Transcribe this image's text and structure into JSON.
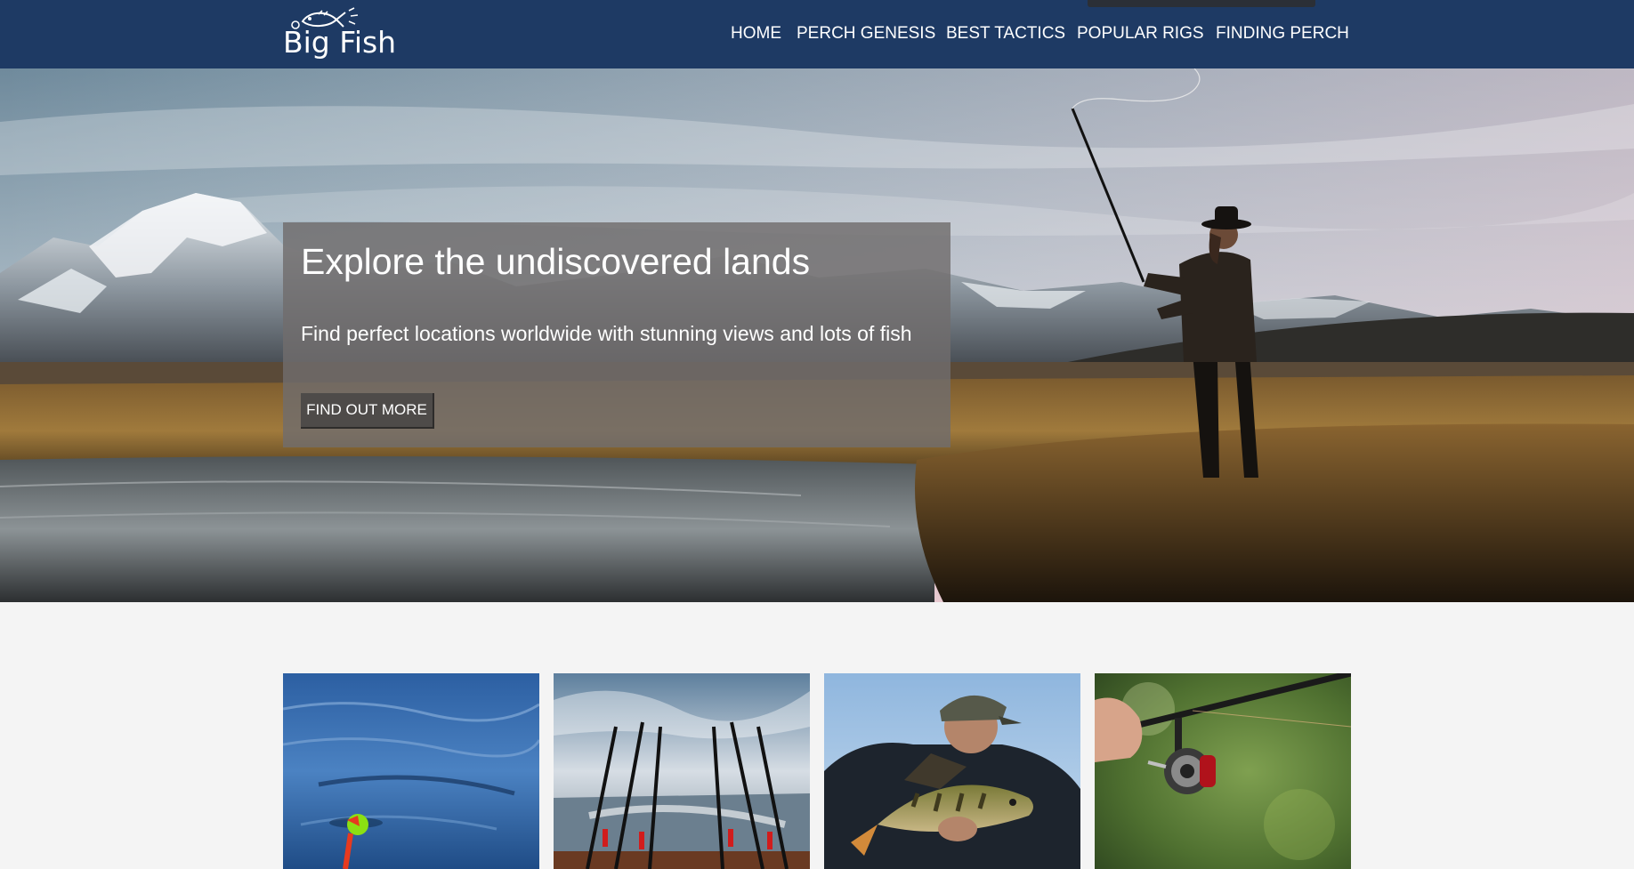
{
  "brand": {
    "logo_text": "Big Fish",
    "logo_icon": "fish-icon"
  },
  "nav": {
    "items": [
      {
        "label": "HOME"
      },
      {
        "label": "PERCH GENESIS"
      },
      {
        "label": "BEST TACTICS"
      },
      {
        "label": "POPULAR RIGS"
      },
      {
        "label": "FINDING PERCH"
      }
    ]
  },
  "hero": {
    "title": "Explore the undiscovered lands",
    "subtitle": "Find perfect locations worldwide with stunning views and lots of fish",
    "button_label": "FIND OUT MORE",
    "image": "fisherman-casting-mountain-lake-image"
  },
  "cards": [
    {
      "image": "fishing-float-in-water-image"
    },
    {
      "image": "fishing-rods-on-boat-image"
    },
    {
      "image": "angler-holding-perch-image"
    },
    {
      "image": "spinning-reel-and-rod-image"
    }
  ],
  "colors": {
    "header_bg": "#1e3a64",
    "page_bg": "#f4f4f4",
    "hero_box_bg": "#706c6c",
    "button_bg": "#4e4b49"
  }
}
